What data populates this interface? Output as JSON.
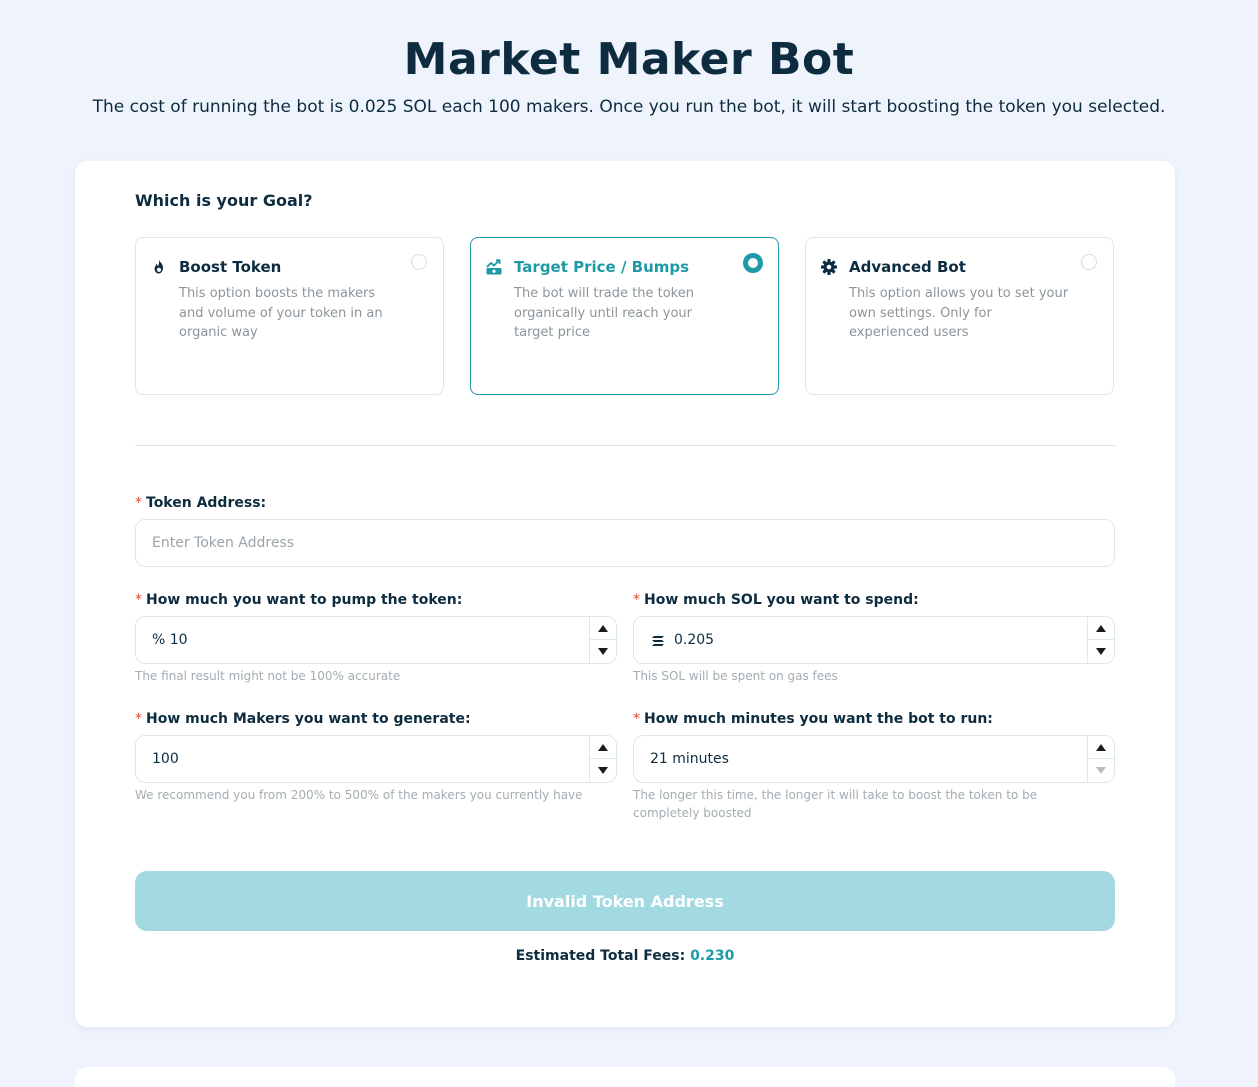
{
  "header": {
    "title": "Market Maker Bot",
    "subtitle": "The cost of running the bot is 0.025 SOL each 100 makers. Once you run the bot, it will start boosting the token you selected."
  },
  "goal": {
    "heading": "Which is your Goal?",
    "options": [
      {
        "title": "Boost Token",
        "description": "This option boosts the makers and volume of your token in an organic way",
        "icon": "fire-icon",
        "selected": false
      },
      {
        "title": "Target Price / Bumps",
        "description": "The bot will trade the token organically until reach your target price",
        "icon": "chart-up-icon",
        "selected": true
      },
      {
        "title": "Advanced Bot",
        "description": "This option allows you to set your own settings. Only for experienced users",
        "icon": "gear-icon",
        "selected": false
      }
    ]
  },
  "form": {
    "required_mark": "*",
    "token_address": {
      "label": "Token Address:",
      "value": "",
      "placeholder": "Enter Token Address"
    },
    "pump": {
      "label": "How much you want to pump the token:",
      "prefix": "%",
      "value": "10",
      "help": "The final result might not be 100% accurate"
    },
    "sol": {
      "label": "How much SOL you want to spend:",
      "value": "0.205",
      "icon": "solana-icon",
      "help": "This SOL will be spent on gas fees"
    },
    "makers": {
      "label": "How much Makers you want to generate:",
      "value": "100",
      "help": "We recommend you from 200% to 500% of the makers you currently have"
    },
    "minutes": {
      "label": "How much minutes you want the bot to run:",
      "value": "21 minutes",
      "help": "The longer this time, the longer it will take to boost the token to be completely boosted"
    }
  },
  "submit": {
    "label": "Invalid Token Address"
  },
  "fees": {
    "label": "Estimated Total Fees:",
    "value": "0.230"
  },
  "colors": {
    "accent": "#1e9aa6",
    "button_disabled": "#a3dae2",
    "required": "#e0473e",
    "background": "#eef3fc"
  }
}
